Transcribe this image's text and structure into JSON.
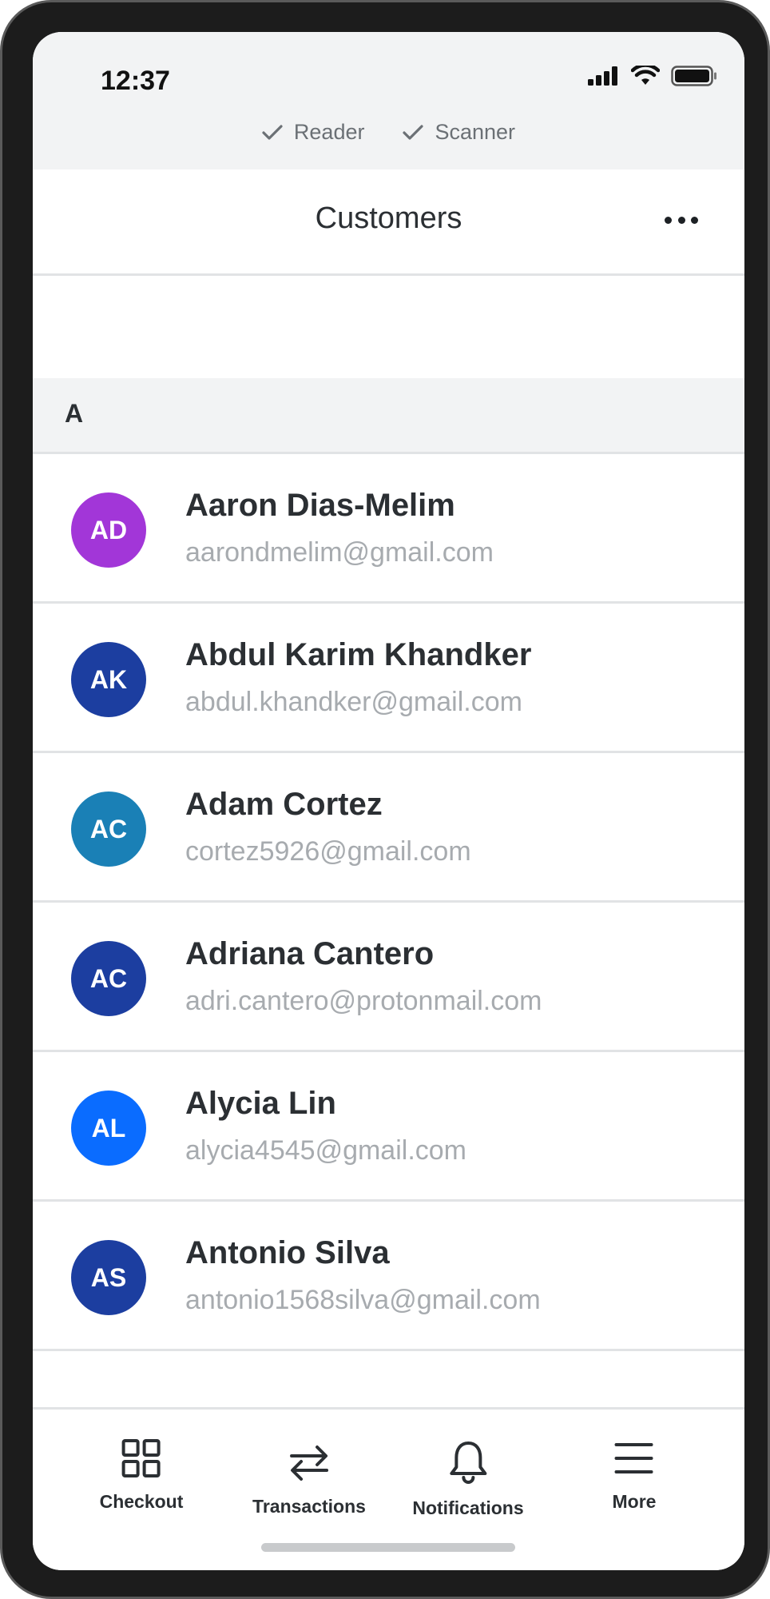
{
  "status_bar": {
    "time": "12:37",
    "connections": [
      {
        "label": "Reader",
        "icon": "check-icon"
      },
      {
        "label": "Scanner",
        "icon": "check-icon"
      }
    ]
  },
  "header": {
    "title": "Customers",
    "more_icon": "more-horizontal-icon"
  },
  "section": {
    "letter": "A"
  },
  "customers": [
    {
      "initials": "AD",
      "name": "Aaron Dias-Melim",
      "email": "aarondmelim@gmail.com",
      "color": "#a236d8"
    },
    {
      "initials": "AK",
      "name": "Abdul Karim Khandker",
      "email": "abdul.khandker@gmail.com",
      "color": "#1c3ea0"
    },
    {
      "initials": "AC",
      "name": "Adam Cortez",
      "email": "cortez5926@gmail.com",
      "color": "#1a80b6"
    },
    {
      "initials": "AC",
      "name": "Adriana Cantero",
      "email": "adri.cantero@protonmail.com",
      "color": "#1c3ea0"
    },
    {
      "initials": "AL",
      "name": "Alycia Lin",
      "email": "alycia4545@gmail.com",
      "color": "#0a6cff"
    },
    {
      "initials": "AS",
      "name": "Antonio Silva",
      "email": "antonio1568silva@gmail.com",
      "color": "#1c3ea0"
    }
  ],
  "tabs": [
    {
      "label": "Checkout",
      "icon": "grid-icon"
    },
    {
      "label": "Transactions",
      "icon": "swap-arrows-icon"
    },
    {
      "label": "Notifications",
      "icon": "bell-icon"
    },
    {
      "label": "More",
      "icon": "menu-icon"
    }
  ]
}
